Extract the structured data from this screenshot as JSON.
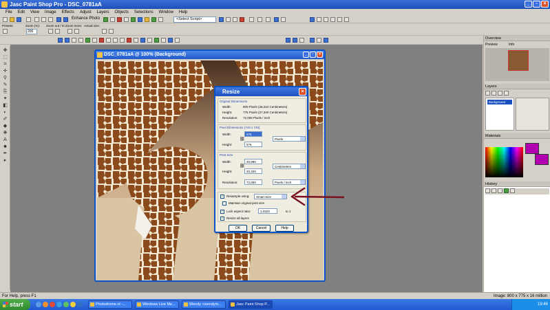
{
  "app": {
    "title": "Jasc Paint Shop Pro - DSC_0781aA"
  },
  "menu": [
    "File",
    "Edit",
    "View",
    "Image",
    "Effects",
    "Adjust",
    "Layers",
    "Objects",
    "Selections",
    "Window",
    "Help"
  ],
  "toolbar": {
    "enhance_photo": "Enhance Photo",
    "script_select": "<Select Script>",
    "presets_label": "Presets:",
    "zoom_pct_label": "Zoom (%):",
    "zoom_value": "200",
    "zoom_out_label": "Zoom out / In:",
    "zoom_more_label": "Zoom more:",
    "actual_size_label": "Actual size:"
  },
  "image_window": {
    "title": "DSC_0781aA @ 100% (Background)"
  },
  "resize_dialog": {
    "title": "Resize",
    "original": {
      "heading": "Original Dimensions",
      "width_label": "Width:",
      "width_value": "800 Pixels (28,222 Centimeters)",
      "height_label": "Height:",
      "height_value": "775 Pixels (27,340 Centimeters)",
      "res_label": "Resolution:",
      "res_value": "72,000 Pixels / Inch"
    },
    "pixel_dims": {
      "heading": "Pixel Dimensions (743 x 745)",
      "width_label": "Width:",
      "width_value": "576",
      "height_label": "Height:",
      "height_value": "576",
      "unit": "Pixels"
    },
    "print_size": {
      "heading": "Print Size",
      "width_label": "Width:",
      "width_value": "20,990",
      "height_label": "Height:",
      "height_value": "20,320",
      "unit": "Centimeters",
      "res_label": "Resolution:",
      "res_value": "72,000",
      "res_unit": "Pixels / Inch"
    },
    "resample_label": "Resample using:",
    "resample_value": "Smart Size",
    "maintain_label": "Maintain original print size",
    "lock_label": "Lock aspect ratio:",
    "lock_value": "1,0323",
    "lock_suffix": "to 1",
    "resize_all_label": "Resize all layers",
    "ok": "OK",
    "cancel": "Cancel",
    "help": "Help"
  },
  "panels": {
    "overview": "Overview",
    "overview_tabs": [
      "Preview",
      "Info"
    ],
    "layers": "Layers",
    "layer_name": "Background",
    "materials": "Materials",
    "history": "History"
  },
  "status": {
    "left": "For Help, press F1",
    "right": "Image:  800 x 775 x 16 million"
  },
  "taskbar": {
    "start": "start",
    "tasks": [
      "Photodrome.nl -...",
      "Windows Live Me...",
      "Wendy <wendym...",
      "Jasc Paint Shop P..."
    ],
    "clock": "19:46"
  },
  "colors": {
    "arrow": "#7a1020",
    "accent": "#0a52c8"
  }
}
